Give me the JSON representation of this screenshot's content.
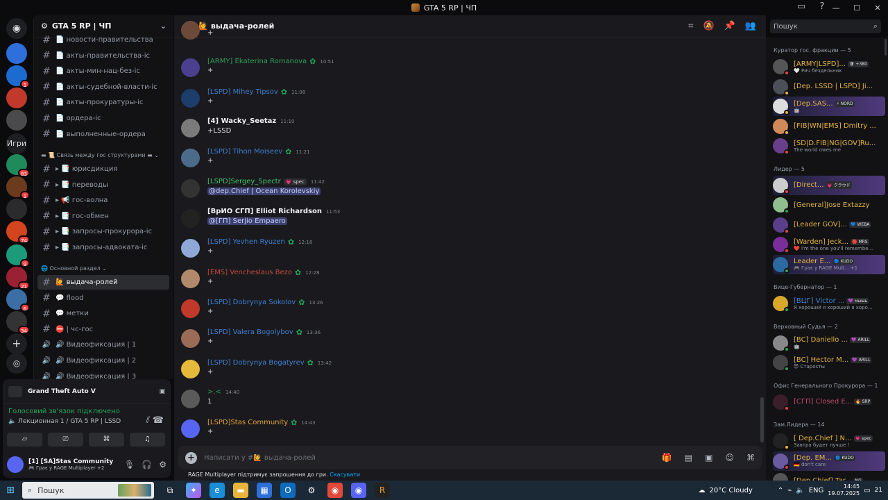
{
  "window": {
    "title": "GTA 5 RP | ЧП"
  },
  "server": {
    "name": "GTA 5 RP | ЧП"
  },
  "rail": {
    "games_label": "Игри",
    "servers": [
      {
        "color": "#2e6fdb",
        "badge": "",
        "top": 0
      },
      {
        "color": "#1c6bd1",
        "badge": "1"
      },
      {
        "color": "#c0392b",
        "badge": ""
      },
      {
        "color": "#4a4a4a",
        "badge": ""
      },
      {
        "color": "#1f8a5a",
        "badge": "83"
      },
      {
        "color": "#6c3b1e",
        "badge": "1"
      },
      {
        "color": "#2b2b2b",
        "badge": ""
      },
      {
        "color": "#d2451e",
        "badge": "74"
      },
      {
        "color": "#1c9b7a",
        "badge": "9"
      },
      {
        "color": "#9a2133",
        "badge": "21"
      },
      {
        "color": "#3a6ea5",
        "badge": "6"
      },
      {
        "color": "#333333",
        "badge": "34"
      }
    ]
  },
  "channels": {
    "items": [
      {
        "label": "📄 новости-правительства",
        "kind": "text"
      },
      {
        "label": "📄 акты-правительства-іс",
        "kind": "text"
      },
      {
        "label": "📄 акты-мин-нац-без-іс",
        "kind": "text"
      },
      {
        "label": "📄 акты-судебной-власти-іс",
        "kind": "text"
      },
      {
        "label": "📄 акты-прокуратуры-іс",
        "kind": "text"
      },
      {
        "label": "📄 ордера-іс",
        "kind": "text"
      },
      {
        "label": "📄 выполненные-ордера",
        "kind": "text"
      }
    ],
    "category1": "▬ 📜 Связь между гос структурами ▬ ⌄",
    "items2": [
      {
        "label": "▸ 📑 юрисдикция"
      },
      {
        "label": "▸ 📑 переводы"
      },
      {
        "label": "▸ 📢 гос-волна"
      },
      {
        "label": "▸ 📑 гос-обмен"
      },
      {
        "label": "▸ 📑 запросы-прокурора-іс"
      },
      {
        "label": "▸ 📑 запросы-адвоката-іс"
      }
    ],
    "category2": "🌐 Основной раздел ⌄",
    "items3": [
      {
        "label": "🙋 выдача-ролей",
        "kind": "text",
        "active": true
      },
      {
        "label": "💬 flood",
        "kind": "text"
      },
      {
        "label": "💬 метки",
        "kind": "text"
      },
      {
        "label": "⛔ | чс-гос",
        "kind": "text"
      },
      {
        "label": "🔊 Видеофиксация | 1",
        "kind": "voice"
      },
      {
        "label": "🔊 Видеофиксация | 2",
        "kind": "voice"
      },
      {
        "label": "🔊 Видеофиксация | 3",
        "kind": "voice"
      }
    ]
  },
  "panel": {
    "game": "Grand Theft Auto V",
    "voice_status": "Голосовий зв'язок підключено",
    "voice_channel": "🔈 Лекционная 1 / GTA 5 RP | LSSD",
    "user_name": "[1] [SA]Stas Community",
    "user_sub": "🎮 Грає у RAGE Multiplayer +2"
  },
  "chat": {
    "channel": "🙋 выдача-ролей",
    "placeholder": "Написати у #🙋 выдача-ролей",
    "hint_text": "RAGE Multiplayer підтримує запрошення до гри.",
    "hint_link": "Скасувати",
    "messages": [
      {
        "author": "",
        "color": "#dbdee1",
        "time": "",
        "body": "+",
        "avatar": "#6b4a3a",
        "badge": false
      },
      {
        "author": "[ARMY] Ekaterina Romanova",
        "color": "#2f9e58",
        "time": "10:51",
        "body": "+",
        "avatar": "#4b3f8f",
        "badge": true
      },
      {
        "author": "[LSPD] Mihey Tipsov",
        "color": "#3f7fd0",
        "time": "11:08",
        "body": "+",
        "avatar": "#1d3d6a",
        "badge": true
      },
      {
        "author": "[4] Wacky_Seetaz",
        "color": "#f2f3f5",
        "time": "11:10",
        "body": "+LSSD",
        "avatar": "#7b7b7b",
        "badge": false
      },
      {
        "author": "[LSPD] Tihon Moiseev",
        "color": "#3f7fd0",
        "time": "11:21",
        "body": "+",
        "avatar": "#4c6b8a",
        "badge": true
      },
      {
        "author": "[LSPD]Sergey_Spectr",
        "color": "#3fc46b",
        "time": "11:42",
        "body": "@dep.Chief | Ocean Korolevskiy",
        "mention": true,
        "tag": "💗 spec",
        "avatar": "#333333",
        "badge": false
      },
      {
        "author": "[ВрИО СГП] Elliot Richardson",
        "color": "#f2f3f5",
        "time": "11:53",
        "body": "@[ГП] Serjio Empaero",
        "mention": true,
        "avatar": "#222222",
        "badge": false
      },
      {
        "author": "[LSPD] Yevhen Ryuzen",
        "color": "#3f7fd0",
        "time": "12:18",
        "body": "+",
        "avatar": "#8fa8d8",
        "badge": true
      },
      {
        "author": "[EMS] Vencheslaus Bezo",
        "color": "#c24a3c",
        "time": "12:28",
        "body": "+",
        "avatar": "#b08a6a",
        "badge": true
      },
      {
        "author": "[LSPD] Dobrynya Sokolov",
        "color": "#3f7fd0",
        "time": "13:26",
        "body": "+",
        "avatar": "#c0392b",
        "badge": true
      },
      {
        "author": "[LSPD] Valera Bogolybov",
        "color": "#3f7fd0",
        "time": "13:36",
        "body": "+",
        "avatar": "#9a6b55",
        "badge": true
      },
      {
        "author": "[LSPD] Dobrynya Bogatyrev",
        "color": "#3f7fd0",
        "time": "13:42",
        "body": "+",
        "avatar": "#e5b93a",
        "badge": true
      },
      {
        "author": ">.<",
        "color": "#2f9e58",
        "time": "14:40",
        "body": "1",
        "avatar": "#5a5a5a",
        "badge": false
      },
      {
        "author": "[LSPD]Stas Community",
        "color": "#e3a33a",
        "time": "14:43",
        "body": "+",
        "avatar": "#5865f2",
        "badge": true
      }
    ]
  },
  "search": {
    "placeholder": "Пошук"
  },
  "members": {
    "groups": [
      {
        "title": "Куратор гос. фракции — 5",
        "members": [
          {
            "name": "[ARMY|LSPD]...",
            "color": "#e3b341",
            "tag": "🛡 +380",
            "activity": "🤍 Рич бездельник",
            "av": "#555",
            "st": "#f23f43"
          },
          {
            "name": "[Dep. LSSD | LSPD] Ji...",
            "color": "#e3b341",
            "tag": "",
            "activity": "",
            "av": "#4b4f57",
            "st": "#f0b232"
          },
          {
            "name": "[Dep.SAS...",
            "color": "#e3b341",
            "tag": "⚡ NORD",
            "activity": "🤖",
            "av": "#ddd",
            "st": "#f0b232",
            "boost": true
          },
          {
            "name": "[FIB|WN|EMS] Dmitry ...",
            "color": "#e3b341",
            "tag": "",
            "activity": "",
            "av": "#d08a5a",
            "st": "#f0b232"
          },
          {
            "name": "[SD|D.FIB|NG|GOV]Ru...",
            "color": "#e3b341",
            "tag": "",
            "activity": "The world owes me",
            "av": "#6a3e8a",
            "st": "#f23f43"
          }
        ]
      },
      {
        "title": "Лидер — 5",
        "members": [
          {
            "name": "[Direct...",
            "color": "#e3b341",
            "tag": "💗 クラウド",
            "activity": "",
            "av": "#ccc",
            "st": "#f23f43",
            "boost": true
          },
          {
            "name": "[General]Jose Extazzy",
            "color": "#e3b341",
            "tag": "",
            "activity": "",
            "av": "#8fbf8f",
            "st": "#23a55a"
          },
          {
            "name": "[Leader GOV]...",
            "color": "#e3b341",
            "tag": "💙 WEBA",
            "activity": "",
            "av": "#5a3e8a",
            "st": "#f23f43"
          },
          {
            "name": "[Warden] Jeck...",
            "color": "#e3b341",
            "tag": "🔴 MRS",
            "activity": "❤️ I'm the one you'll remembe...",
            "av": "#7a2e9a",
            "st": "#f23f43"
          },
          {
            "name": "Leader E...",
            "color": "#e3b341",
            "tag": "🔵 KUDO",
            "activity": "🎮 Грає у RAGE Mult... +1",
            "av": "#2b6aa0",
            "st": "#23a55a",
            "boost": true
          }
        ]
      },
      {
        "title": "Вице-Губернатор — 1",
        "members": [
          {
            "name": "[ВЦГ] Victor ...",
            "color": "#3f7fd0",
            "tag": "💜 мышь",
            "activity": "Я хороший я хороший я хоро...",
            "av": "#d8a82a",
            "st": "#23a55a"
          }
        ]
      },
      {
        "title": "Верховный Судья — 2",
        "members": [
          {
            "name": "[BC] Daniello ...",
            "color": "#e3b341",
            "tag": "💜 ARILL",
            "activity": "🤖",
            "av": "#888",
            "st": "#23a55a"
          },
          {
            "name": "[BC] Hector M...",
            "color": "#e3b341",
            "tag": "💜 ARILL",
            "activity": "😈 Старосты",
            "av": "#444",
            "st": "#23a55a"
          }
        ]
      },
      {
        "title": "Офис Генерального Прокурора — 1",
        "members": [
          {
            "name": "[СГП] Closed E...",
            "color": "#c24a6a",
            "tag": "🔥 SRP",
            "activity": "",
            "av": "#3a1e2a",
            "st": "#f23f43"
          }
        ]
      },
      {
        "title": "Зам.Лидера — 14",
        "members": [
          {
            "name": "[ Dep.Chief ] N...",
            "color": "#e3b341",
            "tag": "💗 spec",
            "activity": "Завтра будет лучше !",
            "av": "#222",
            "st": "#f0b232"
          },
          {
            "name": "[Dep. EM...",
            "color": "#e3b341",
            "tag": "🔵 KUDO",
            "activity": "🇩🇪 don't care",
            "av": "#6a5aa0",
            "st": "#f23f43",
            "boost": true
          },
          {
            "name": "[Dep.Chief] Tar...",
            "color": "#e3b341",
            "tag": "NG",
            "activity": "",
            "av": "#555",
            "st": "#f23f43"
          }
        ]
      }
    ]
  },
  "taskbar": {
    "search": "Пошук",
    "weather": "20°C Cloudy",
    "lang": "ENG",
    "time": "14:45",
    "date": "19.07.2025",
    "notif": "21"
  }
}
